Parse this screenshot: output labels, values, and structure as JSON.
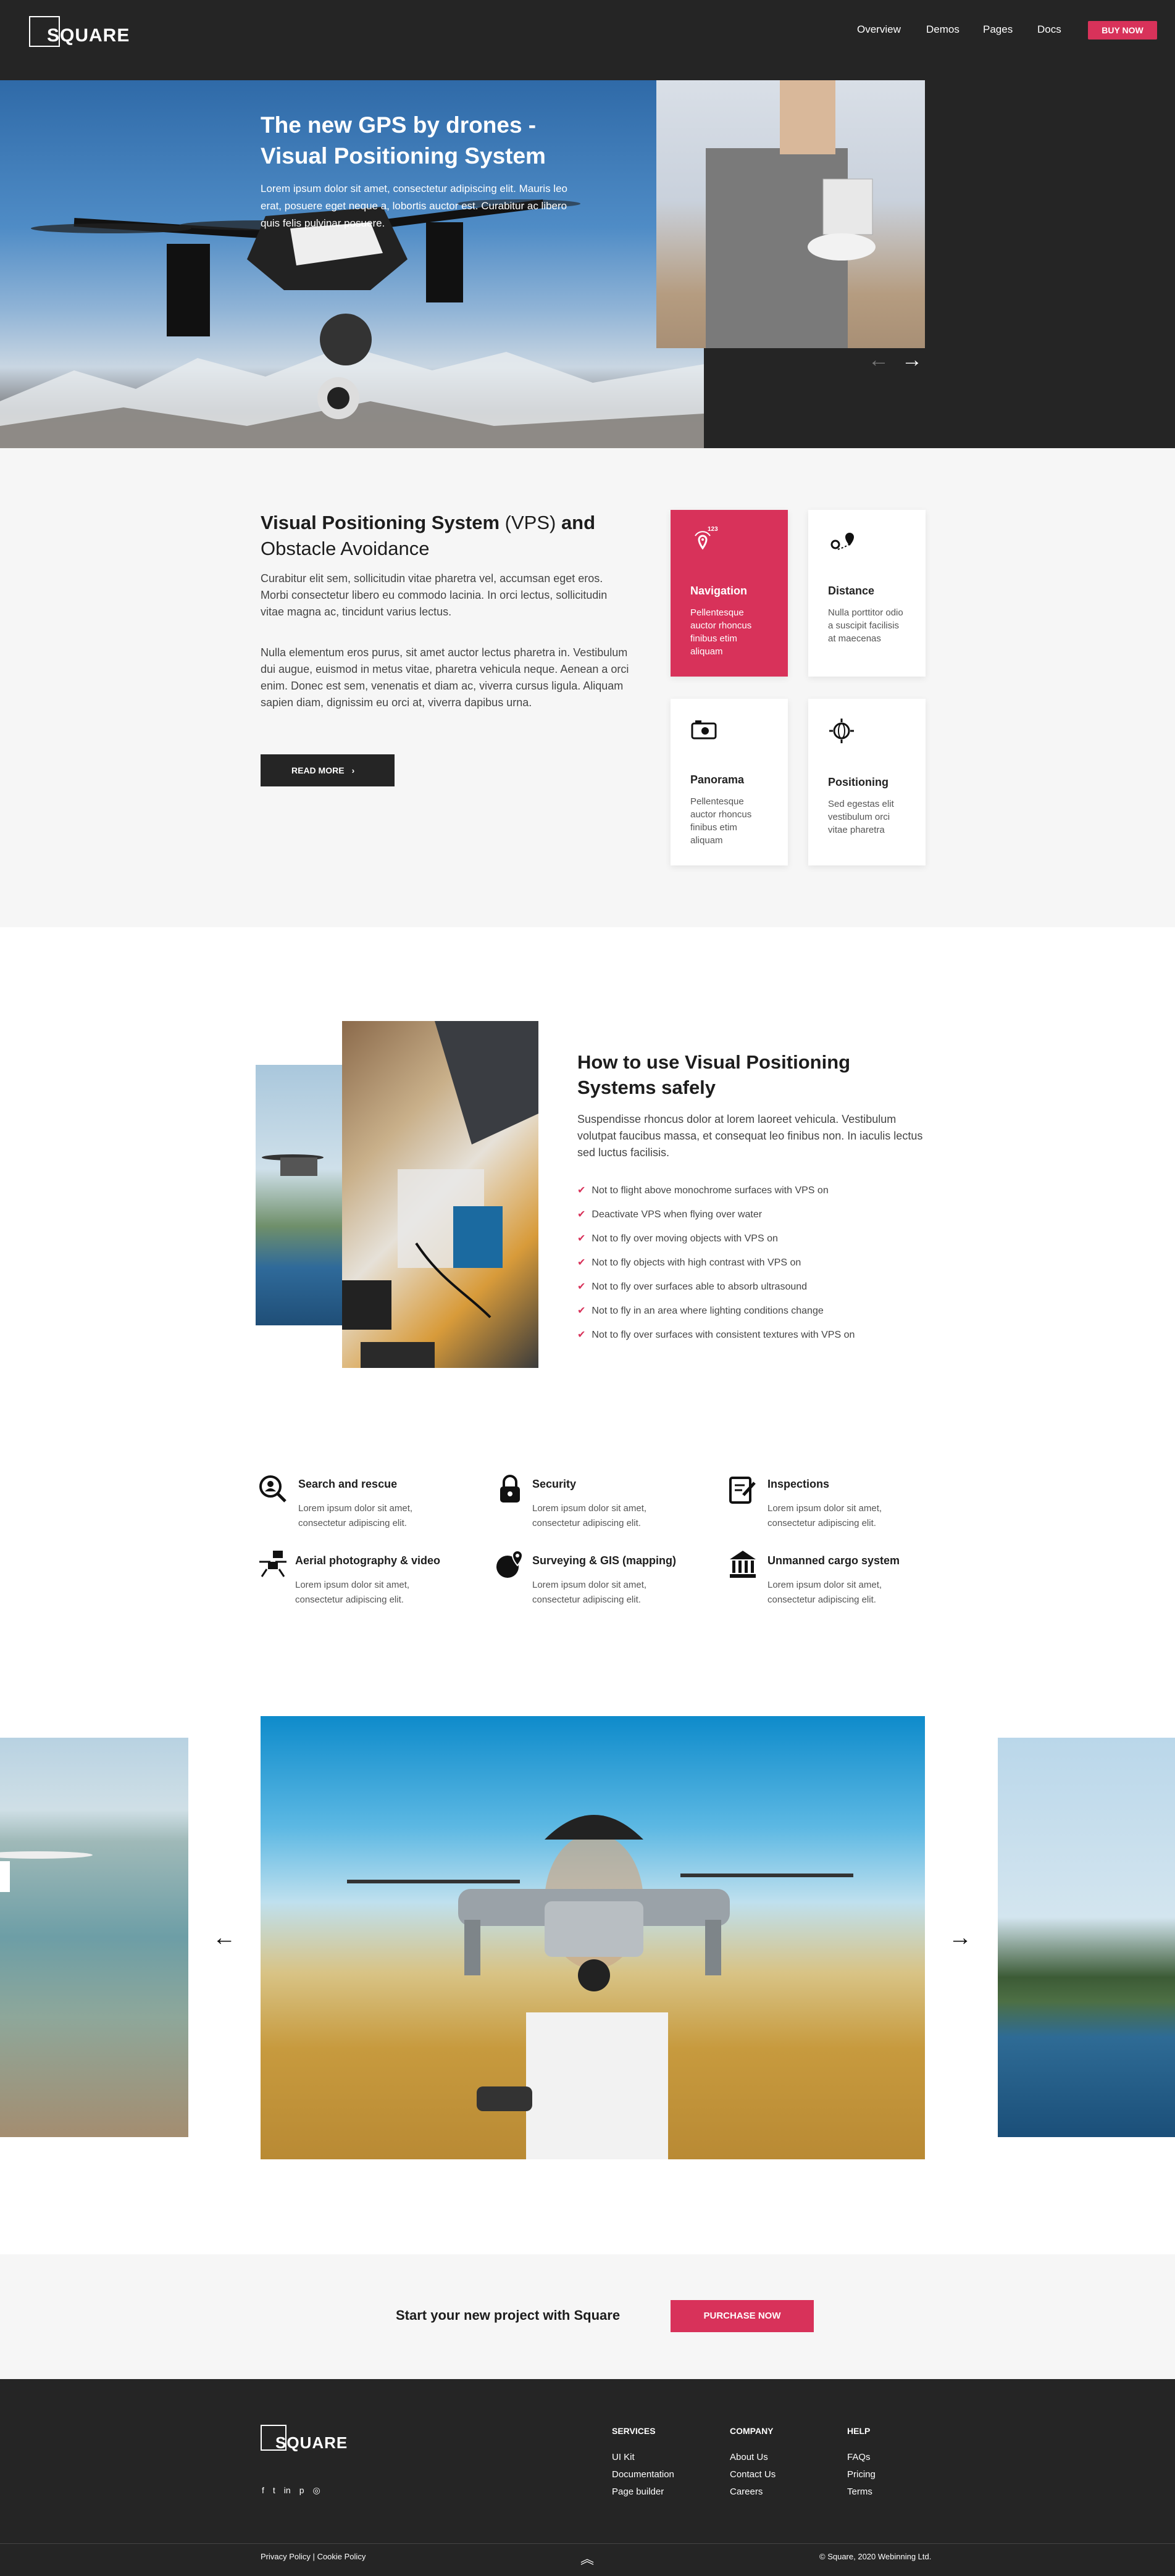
{
  "header": {
    "logo": "SQUARE",
    "nav": [
      "Overview",
      "Demos",
      "Pages",
      "Docs"
    ],
    "buy_now": "BUY NOW"
  },
  "hero": {
    "title_line1": "The new GPS by drones -",
    "title_line2": "Visual Positioning System",
    "text": "Lorem ipsum dolor sit amet, consectetur adipiscing elit. Mauris leo erat, posuere eget neque a, lobortis auctor est. Curabitur ac libero quis felis pulvinar posuere.",
    "prev_arrow": "←",
    "next_arrow": "→"
  },
  "vps": {
    "title_bold": "Visual Positioning System",
    "title_vps": " (VPS) ",
    "title_and": "and",
    "title_line2": "Obstacle Avoidance",
    "para1": "Curabitur elit sem, sollicitudin vitae pharetra vel, accumsan eget eros. Morbi consectetur libero eu commodo lacinia. In orci lectus, sollicitudin vitae magna ac, tincidunt varius lectus.",
    "para2": "Nulla elementum eros purus, sit amet auctor lectus pharetra in. Vestibulum dui augue, euismod in metus vitae, pharetra vehicula neque. Aenean a orci enim. Donec est sem, venenatis et diam ac, viverra cursus ligula. Aliquam sapien diam, dignissim eu orci at, viverra dapibus urna.",
    "read_more": "READ MORE"
  },
  "cards": [
    {
      "title": "Navigation",
      "text": "Pellentesque auctor rhoncus finibus etim aliquam",
      "icon": "gps-satellite-icon",
      "badge": "123"
    },
    {
      "title": "Distance",
      "text": "Nulla porttitor odio a suscipit facilisis at maecenas",
      "icon": "map-pin-icon"
    },
    {
      "title": "Panorama",
      "text": "Pellentesque auctor rhoncus finibus etim aliquam",
      "icon": "panorama-camera-icon"
    },
    {
      "title": "Positioning",
      "text": "Sed egestas elit vestibulum orci vitae pharetra",
      "icon": "globe-crosshair-icon"
    }
  ],
  "howto": {
    "title": "How to use Visual Positioning Systems safely",
    "text": "Suspendisse rhoncus dolor at lorem laoreet vehicula. Vestibulum volutpat faucibus massa, et consequat leo finibus non. In iaculis lectus sed luctus facilisis.",
    "checklist": [
      "Not to flight above monochrome surfaces with VPS on",
      "Deactivate VPS when flying over water",
      "Not to fly over moving objects with VPS on",
      "Not to fly objects with high contrast with VPS on",
      "Not to fly over surfaces able to absorb ultrasound",
      "Not to fly in an area where lighting conditions change",
      "Not to fly over surfaces with consistent textures with VPS on"
    ]
  },
  "services": [
    {
      "title": "Search and rescue",
      "text": "Lorem ipsum dolor sit amet, consectetur adipiscing elit.",
      "icon": "search-person-icon"
    },
    {
      "title": "Security",
      "text": "Lorem ipsum dolor sit amet, consectetur adipiscing elit.",
      "icon": "lock-icon"
    },
    {
      "title": "Inspections",
      "text": "Lorem ipsum dolor sit amet, consectetur adipiscing elit.",
      "icon": "clipboard-check-icon"
    },
    {
      "title": "Aerial photography & video",
      "text": "Lorem ipsum dolor sit amet, consectetur adipiscing elit.",
      "icon": "drone-camera-icon"
    },
    {
      "title": "Surveying & GIS (mapping)",
      "text": "Lorem ipsum dolor sit amet, consectetur adipiscing elit.",
      "icon": "globe-pin-icon"
    },
    {
      "title": "Unmanned cargo system",
      "text": "Lorem ipsum dolor sit amet, consectetur adipiscing elit.",
      "icon": "bank-building-icon"
    }
  ],
  "slider": {
    "prev_arrow": "←",
    "next_arrow": "→"
  },
  "cta": {
    "text": "Start your new project with Square",
    "button": "PURCHASE NOW"
  },
  "footer": {
    "logo": "SQUARE",
    "columns": [
      {
        "heading": "SERVICES",
        "links": [
          "UI Kit",
          "Documentation",
          "Page builder"
        ]
      },
      {
        "heading": "COMPANY",
        "links": [
          "About Us",
          "Contact Us",
          "Careers"
        ]
      },
      {
        "heading": "HELP",
        "links": [
          "FAQs",
          "Pricing",
          "Terms"
        ]
      }
    ],
    "social": [
      "facebook-icon",
      "twitter-icon",
      "linkedin-icon",
      "pinterest-icon",
      "dribbble-icon"
    ],
    "privacy": "Privacy Policy",
    "separator": "|",
    "cookie": "Cookie Policy",
    "copyright": "© Square, 2020 Webinning Ltd.",
    "scroll_top": "︽"
  },
  "colors": {
    "accent": "#d8325a",
    "dark": "#252525",
    "light_bg": "#f6f6f6"
  }
}
